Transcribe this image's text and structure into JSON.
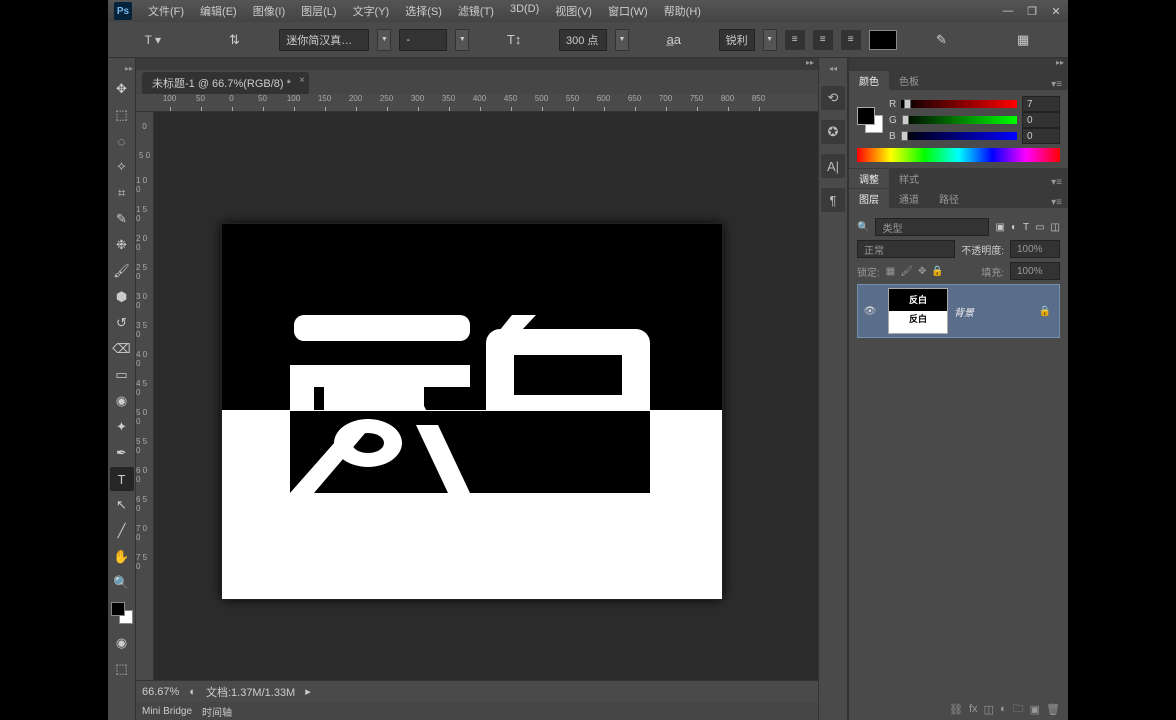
{
  "titlebar": {
    "app_abbrev": "Ps",
    "menus": [
      "文件(F)",
      "编辑(E)",
      "图像(I)",
      "图层(L)",
      "文字(Y)",
      "选择(S)",
      "滤镜(T)",
      "3D(D)",
      "视图(V)",
      "窗口(W)",
      "帮助(H)"
    ]
  },
  "options": {
    "font_family": "迷你简汉真…",
    "font_style": "-",
    "font_size": "300 点",
    "antialias": "锐利"
  },
  "document": {
    "tab_title": "未标题-1 @ 66.7%(RGB/8) *",
    "zoom": "66.67%",
    "doc_info": "文档:1.37M/1.33M"
  },
  "ruler_h": [
    "100",
    "50",
    "0",
    "50",
    "100",
    "150",
    "200",
    "250",
    "300",
    "350",
    "400",
    "450",
    "500",
    "550",
    "600",
    "650",
    "700",
    "750",
    "800",
    "850"
  ],
  "ruler_v": [
    "0",
    "5 0",
    "1 0 0",
    "1 5 0",
    "2 0 0",
    "2 5 0",
    "3 0 0",
    "3 5 0",
    "4 0 0",
    "4 5 0",
    "5 0 0",
    "5 5 0",
    "6 0 0",
    "6 5 0",
    "7 0 0",
    "7 5 0"
  ],
  "bottom_tabs": [
    "Mini Bridge",
    "时间轴"
  ],
  "panels": {
    "color_tab": "颜色",
    "swatches_tab": "色板",
    "r_label": "R",
    "g_label": "G",
    "b_label": "B",
    "r_val": "7",
    "g_val": "0",
    "b_val": "0",
    "adjust_tab": "调整",
    "styles_tab": "样式",
    "layers_tab": "图层",
    "channels_tab": "通道",
    "paths_tab": "路径",
    "filter_label": "类型",
    "blend_mode": "正常",
    "opacity_label": "不透明度:",
    "opacity_value": "100%",
    "lock_label": "锁定:",
    "fill_label": "填充:",
    "fill_value": "100%",
    "layer0_name": "背景"
  }
}
